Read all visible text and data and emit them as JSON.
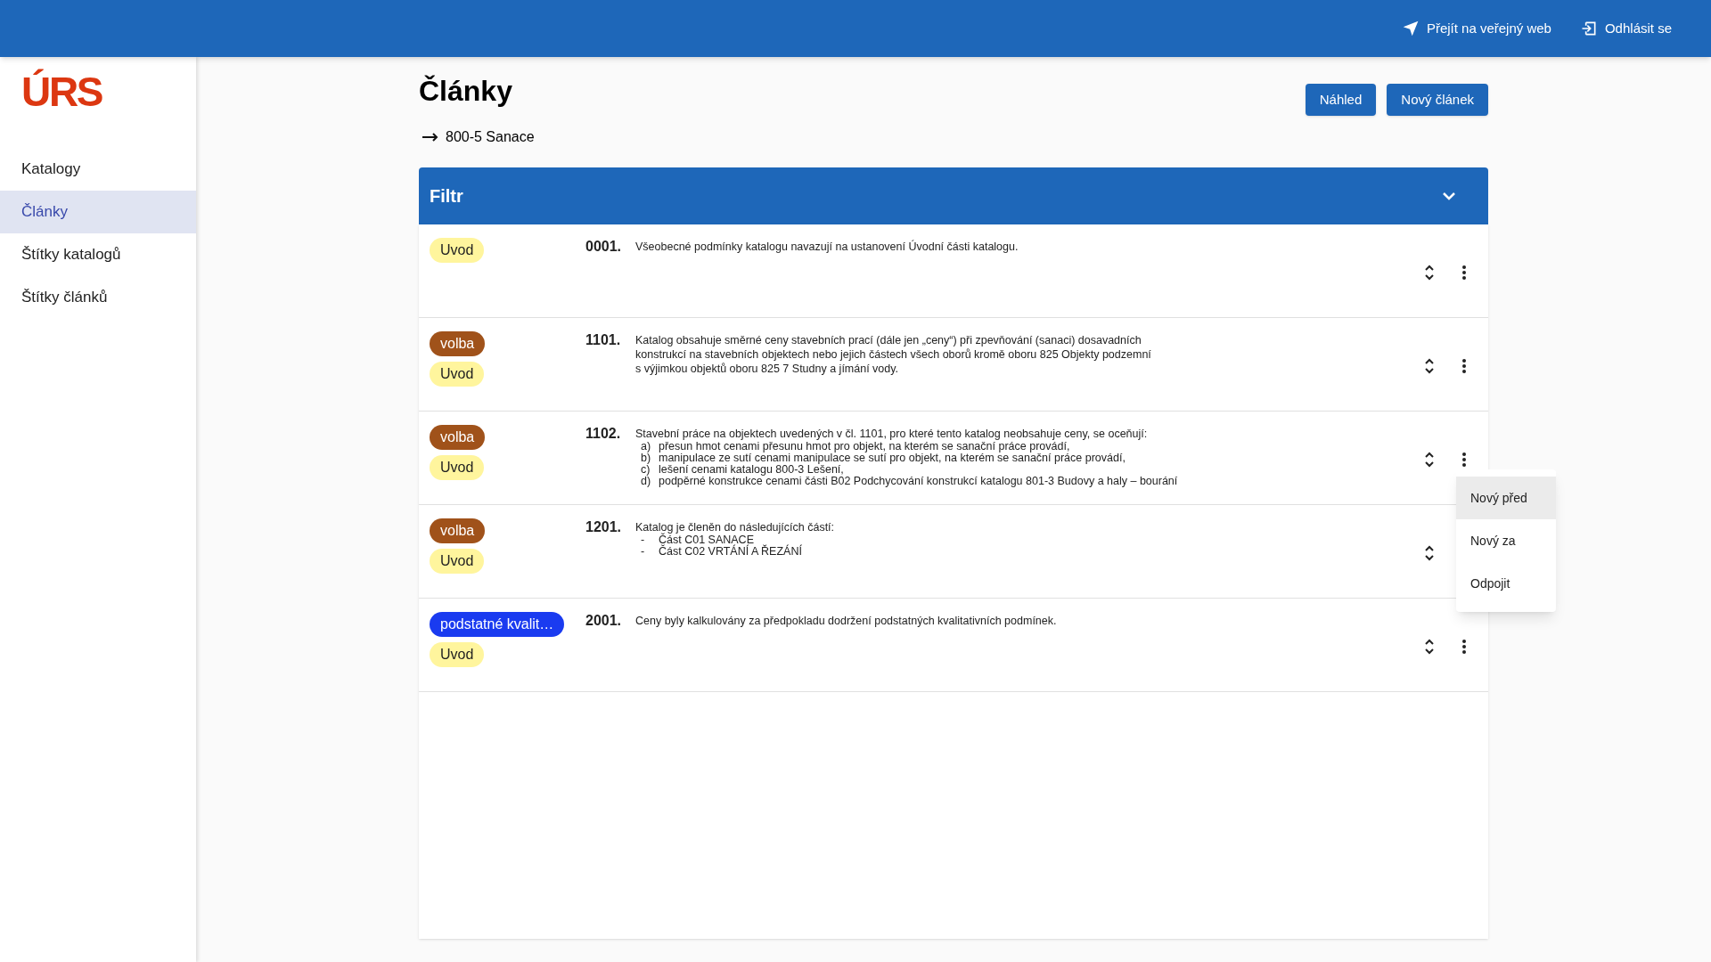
{
  "header": {
    "links": [
      {
        "label": "Přejít na veřejný web",
        "kind": "web"
      },
      {
        "label": "Odhlásit se",
        "kind": "logout"
      }
    ]
  },
  "sidebar": {
    "logo": "ÚRS",
    "items": [
      {
        "label": "Katalogy",
        "selected": false
      },
      {
        "label": "Články",
        "selected": true
      },
      {
        "label": "Štítky katalogů",
        "selected": false
      },
      {
        "label": "Štítky článků",
        "selected": false
      }
    ]
  },
  "page": {
    "title": "Články",
    "buttons": [
      "Náhled",
      "Nový článek"
    ],
    "breadcrumb": "800-5 Sanace"
  },
  "filter": {
    "title": "Filtr",
    "expanded": false
  },
  "rows": [
    {
      "number": "0001.",
      "tags": [
        {
          "label": "Uvod",
          "color": "#fff59d"
        }
      ],
      "text": [
        "Všeobecné podmínky katalogu navazují na ustanovení Úvodní části katalogu."
      ],
      "list": [],
      "menu_open": false
    },
    {
      "number": "1101.",
      "tags": [
        {
          "label": "volba",
          "color": "#a0521a"
        },
        {
          "label": "Uvod",
          "color": "#fff59d"
        }
      ],
      "text": [
        "Katalog obsahuje směrné ceny stavebních prací (dále jen „ceny“) při zpevňování (sanaci) dosavadních",
        "konstrukcí na stavebních objektech nebo jejich částech všech oborů kromě oboru 825 Objekty podzemní",
        "s výjimkou objektů oboru 825 7 Studny a jímání vody."
      ],
      "list": [],
      "menu_open": false
    },
    {
      "number": "1102.",
      "tags": [
        {
          "label": "volba",
          "color": "#a0521a"
        },
        {
          "label": "Uvod",
          "color": "#fff59d"
        }
      ],
      "text": [
        "Stavební práce na objektech uvedených v čl. 1101, pro které tento katalog neobsahuje ceny, se oceňují:"
      ],
      "list": [
        {
          "mark": "a)",
          "text": "přesun hmot cenami přesunu hmot pro objekt, na kterém se sanační práce provádí,"
        },
        {
          "mark": "b)",
          "text": "manipulace ze sutí cenami manipulace se sutí pro objekt, na kterém se sanační práce provádí,"
        },
        {
          "mark": "c)",
          "text": "lešení cenami katalogu 800-3 Lešení,"
        },
        {
          "mark": "d)",
          "text": "podpěrné konstrukce cenami části B02 Podchycování konstrukcí katalogu 801-3 Budovy a haly – bourání"
        }
      ],
      "menu_open": true
    },
    {
      "number": "1201.",
      "tags": [
        {
          "label": "volba",
          "color": "#a0521a"
        },
        {
          "label": "Uvod",
          "color": "#fff59d"
        }
      ],
      "text": [
        "Katalog je členěn do následujících částí:"
      ],
      "list": [
        {
          "mark": "-",
          "text": "Část C01 SANACE"
        },
        {
          "mark": "-",
          "text": "Část C02 VRTÁNÍ A ŘEZÁNÍ"
        }
      ],
      "menu_open": false
    },
    {
      "number": "2001.",
      "tags": [
        {
          "label": "podstatné kvalit…",
          "color": "#1a3bf0"
        },
        {
          "label": "Uvod",
          "color": "#fff59d"
        }
      ],
      "text": [
        "Ceny byly kalkulovány za předpokladu dodržení podstatných kvalitativních podmínek."
      ],
      "list": [],
      "menu_open": false
    }
  ],
  "menu": {
    "items": [
      {
        "label": "Nový před",
        "selected": true
      },
      {
        "label": "Nový za",
        "selected": false
      },
      {
        "label": "Odpojit",
        "selected": false
      }
    ]
  }
}
